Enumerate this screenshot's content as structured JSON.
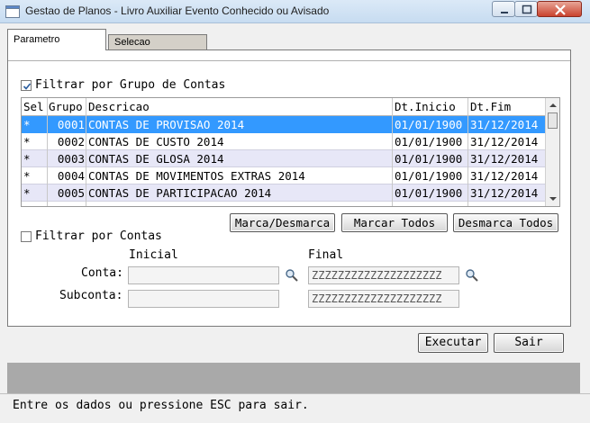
{
  "window": {
    "title": "Gestao de Planos - Livro Auxiliar Evento Conhecido ou Avisado",
    "close_color": "#c9432e"
  },
  "tabs": [
    {
      "label": "Parametro",
      "active": true
    },
    {
      "label": "Selecao",
      "active": false
    }
  ],
  "filter_groups": {
    "label": "Filtrar por Grupo de Contas",
    "checked": true
  },
  "grid": {
    "headers": [
      "Sel",
      "Grupo",
      "Descricao",
      "Dt.Inicio",
      "Dt.Fim"
    ],
    "rows": [
      {
        "sel": "*",
        "grupo": "0001",
        "descricao": "CONTAS DE PROVISAO 2014",
        "inicio": "01/01/1900",
        "fim": "31/12/2014",
        "selected": true
      },
      {
        "sel": "*",
        "grupo": "0002",
        "descricao": "CONTAS DE CUSTO 2014",
        "inicio": "01/01/1900",
        "fim": "31/12/2014",
        "selected": false
      },
      {
        "sel": "*",
        "grupo": "0003",
        "descricao": "CONTAS DE GLOSA 2014",
        "inicio": "01/01/1900",
        "fim": "31/12/2014",
        "selected": false
      },
      {
        "sel": "*",
        "grupo": "0004",
        "descricao": "CONTAS DE MOVIMENTOS EXTRAS 2014",
        "inicio": "01/01/1900",
        "fim": "31/12/2014",
        "selected": false
      },
      {
        "sel": "*",
        "grupo": "0005",
        "descricao": "CONTAS DE PARTICIPACAO 2014",
        "inicio": "01/01/1900",
        "fim": "31/12/2014",
        "selected": false
      }
    ],
    "selection_color": "#3399ff"
  },
  "grid_buttons": {
    "toggle": "Marca/Desmarca",
    "mark_all": "Marcar Todos",
    "unmark_all": "Desmarca Todos"
  },
  "filter_accounts": {
    "label": "Filtrar por Contas",
    "checked": false,
    "col_initial": "Inicial",
    "col_final": "Final",
    "conta_label": "Conta:",
    "subconta_label": "Subconta:",
    "conta_initial": "",
    "conta_final": "ZZZZZZZZZZZZZZZZZZZZ",
    "subconta_initial": "",
    "subconta_final": "ZZZZZZZZZZZZZZZZZZZZ"
  },
  "actions": {
    "execute": "Executar",
    "exit": "Sair"
  },
  "status": {
    "message": "Entre os dados ou pressione ESC para sair."
  }
}
